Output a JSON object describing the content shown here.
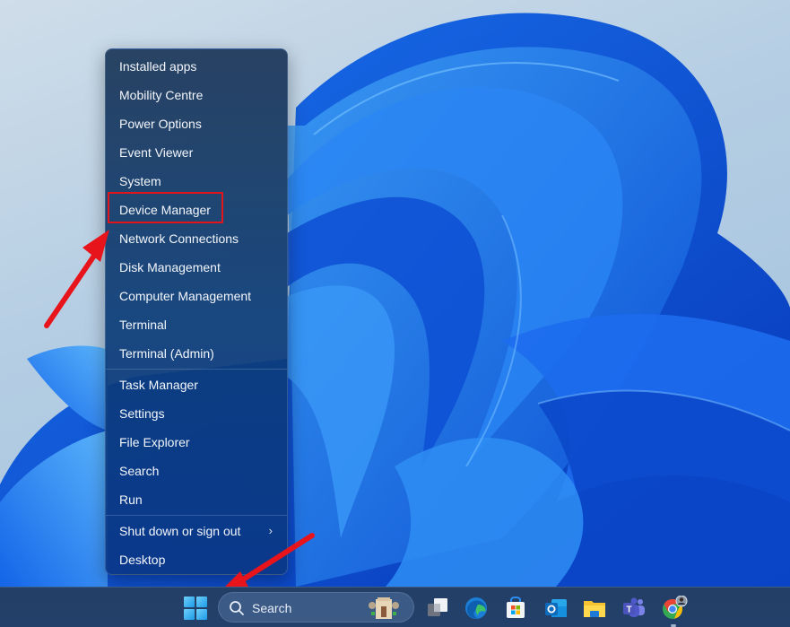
{
  "context_menu": {
    "groups": [
      [
        {
          "label": "Installed apps"
        },
        {
          "label": "Mobility Centre"
        },
        {
          "label": "Power Options"
        },
        {
          "label": "Event Viewer"
        },
        {
          "label": "System"
        },
        {
          "label": "Device Manager",
          "highlighted": true
        },
        {
          "label": "Network Connections"
        },
        {
          "label": "Disk Management"
        },
        {
          "label": "Computer Management"
        },
        {
          "label": "Terminal"
        },
        {
          "label": "Terminal (Admin)"
        }
      ],
      [
        {
          "label": "Task Manager"
        },
        {
          "label": "Settings"
        },
        {
          "label": "File Explorer"
        },
        {
          "label": "Search"
        },
        {
          "label": "Run"
        }
      ],
      [
        {
          "label": "Shut down or sign out",
          "submenu": true,
          "chevron": "›"
        },
        {
          "label": "Desktop"
        }
      ]
    ],
    "highlight_color": "#e4141b"
  },
  "annotations": {
    "arrow_color": "#e8141b",
    "arrows": [
      "points-to-device-manager",
      "points-to-start-button"
    ]
  },
  "taskbar": {
    "start_icon": "windows-logo-icon",
    "search": {
      "placeholder": "Search",
      "icon": "search-icon"
    },
    "pinned_apps": [
      {
        "name": "task-view",
        "icon": "task-view-icon"
      },
      {
        "name": "microsoft-edge",
        "icon": "edge-icon"
      },
      {
        "name": "microsoft-store",
        "icon": "store-icon"
      },
      {
        "name": "outlook",
        "icon": "outlook-icon"
      },
      {
        "name": "file-explorer",
        "icon": "folder-icon"
      },
      {
        "name": "microsoft-teams",
        "icon": "teams-icon"
      },
      {
        "name": "google-chrome",
        "icon": "chrome-icon",
        "running": true
      }
    ]
  }
}
